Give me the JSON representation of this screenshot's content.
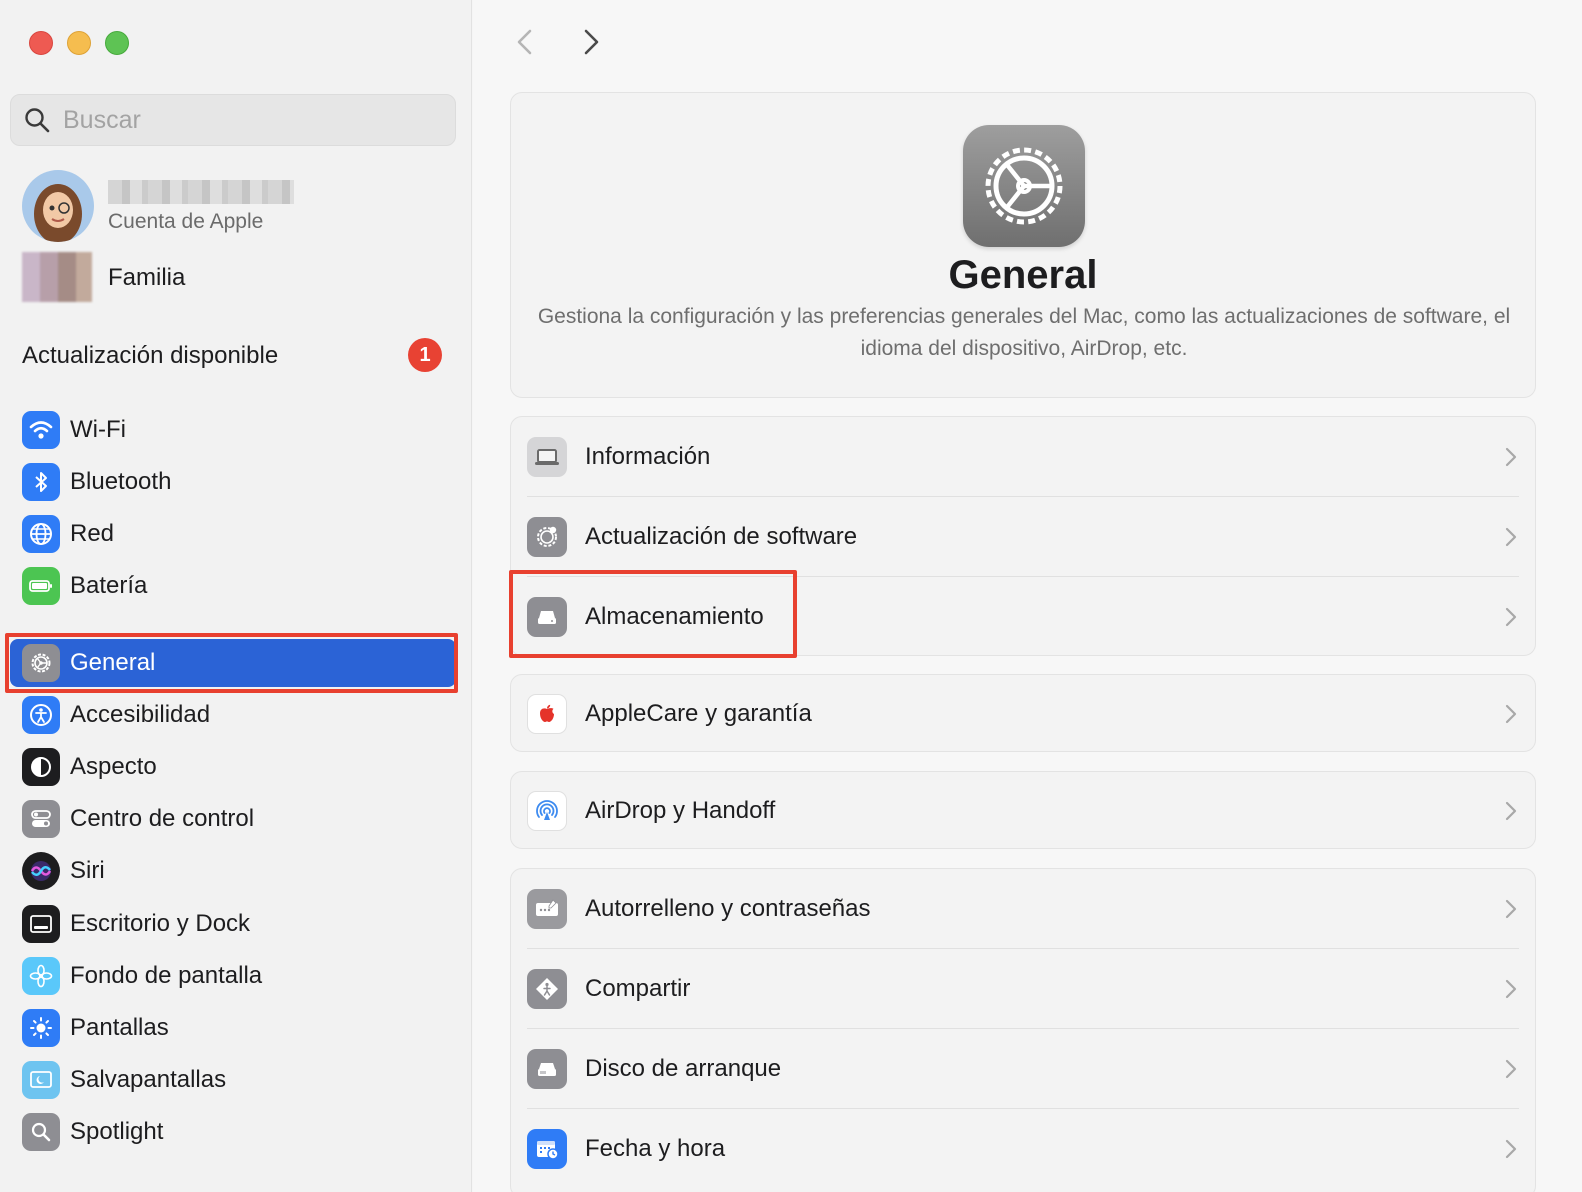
{
  "window": {
    "controls": [
      "close",
      "minimize",
      "maximize"
    ]
  },
  "search": {
    "placeholder": "Buscar",
    "value": ""
  },
  "account": {
    "subtitle": "Cuenta de Apple"
  },
  "family": {
    "label": "Familia"
  },
  "update": {
    "label": "Actualización disponible",
    "count": "1"
  },
  "sidebar": {
    "items": [
      {
        "label": "Wi-Fi",
        "icon": "wifi-icon",
        "color": "#2f7cf6"
      },
      {
        "label": "Bluetooth",
        "icon": "bluetooth-icon",
        "color": "#2f7cf6"
      },
      {
        "label": "Red",
        "icon": "globe-icon",
        "color": "#2f7cf6"
      },
      {
        "label": "Batería",
        "icon": "battery-icon",
        "color": "#4cc552"
      },
      {
        "label": "General",
        "icon": "gear-icon",
        "color": "#8e8e93",
        "selected": true
      },
      {
        "label": "Accesibilidad",
        "icon": "accessibility-icon",
        "color": "#2f7cf6"
      },
      {
        "label": "Aspecto",
        "icon": "appearance-icon",
        "color": "#1d1d1f"
      },
      {
        "label": "Centro de control",
        "icon": "control-center-icon",
        "color": "#8e8e93"
      },
      {
        "label": "Siri",
        "icon": "siri-icon",
        "color": "#1d1d1f"
      },
      {
        "label": "Escritorio y Dock",
        "icon": "dock-icon",
        "color": "#1d1d1f"
      },
      {
        "label": "Fondo de pantalla",
        "icon": "wallpaper-icon",
        "color": "#5ac8fa"
      },
      {
        "label": "Pantallas",
        "icon": "display-icon",
        "color": "#2f7cf6"
      },
      {
        "label": "Salvapantallas",
        "icon": "screensaver-icon",
        "color": "#6ec4f0"
      },
      {
        "label": "Spotlight",
        "icon": "spotlight-icon",
        "color": "#8e8e93"
      }
    ]
  },
  "main": {
    "title": "General",
    "description": "Gestiona la configuración y las preferencias generales del Mac, como las actualizaciones de software, el idioma del dispositivo, AirDrop, etc.",
    "groups": [
      [
        {
          "label": "Información",
          "icon": "laptop-icon"
        },
        {
          "label": "Actualización de software",
          "icon": "software-update-icon"
        },
        {
          "label": "Almacenamiento",
          "icon": "storage-drive-icon",
          "highlighted": true
        }
      ],
      [
        {
          "label": "AppleCare y garantía",
          "icon": "apple-logo-icon"
        }
      ],
      [
        {
          "label": "AirDrop y Handoff",
          "icon": "airdrop-icon"
        }
      ],
      [
        {
          "label": "Autorrelleno y contraseñas",
          "icon": "keyboard-password-icon"
        },
        {
          "label": "Compartir",
          "icon": "sharing-icon"
        },
        {
          "label": "Disco de arranque",
          "icon": "startup-disk-icon"
        },
        {
          "label": "Fecha y hora",
          "icon": "calendar-clock-icon"
        }
      ]
    ]
  },
  "colors": {
    "accent": "#2b63d6",
    "highlight": "#e8402f",
    "badge": "#e84233"
  }
}
